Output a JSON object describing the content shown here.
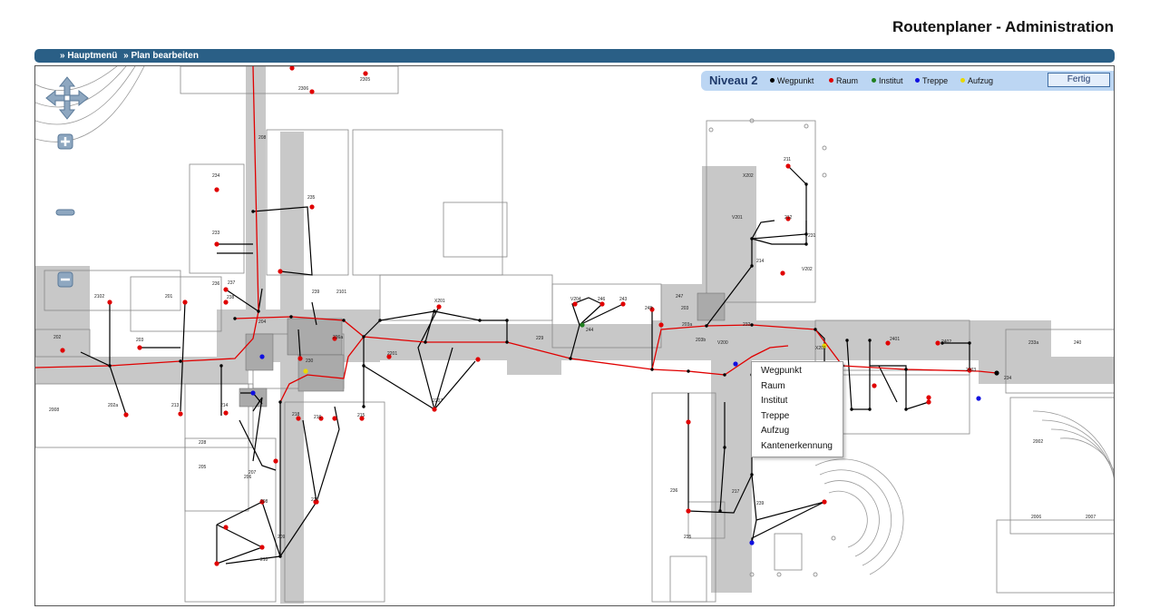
{
  "header": {
    "title": "Routenplaner - Administration"
  },
  "breadcrumb": {
    "items": [
      "» Hauptmenü",
      "» Plan bearbeiten"
    ]
  },
  "legend": {
    "level": "Niveau 2",
    "items": [
      {
        "label": "Wegpunkt",
        "color": "#000000"
      },
      {
        "label": "Raum",
        "color": "#e00000"
      },
      {
        "label": "Institut",
        "color": "#208020"
      },
      {
        "label": "Treppe",
        "color": "#1010e0"
      },
      {
        "label": "Aufzug",
        "color": "#e8d800"
      }
    ],
    "done_button": "Fertig"
  },
  "context_menu": {
    "items": [
      "Wegpunkt",
      "Raum",
      "Institut",
      "Treppe",
      "Aufzug",
      "Kantenerkennung"
    ]
  },
  "map": {
    "room_labels": [
      "2306",
      "2305",
      "208",
      "234",
      "235",
      "233",
      "236",
      "237",
      "238",
      "239",
      "2101",
      "2102",
      "201",
      "202",
      "203",
      "204",
      "230",
      "236a",
      "X201",
      "2201",
      "229",
      "2207",
      "V204",
      "246",
      "243",
      "244",
      "245",
      "247",
      "203",
      "203a",
      "203b",
      "V200",
      "X201",
      "232",
      "V202",
      "211",
      "X202",
      "V201",
      "212",
      "214",
      "231",
      "2401",
      "2402",
      "2403",
      "234",
      "233a",
      "240",
      "2001",
      "2002",
      "2006",
      "2007",
      "2008",
      "202a",
      "213",
      "214",
      "218",
      "216",
      "215",
      "228",
      "205",
      "206",
      "207",
      "208",
      "217",
      "209",
      "210",
      "217",
      "236",
      "235",
      "239"
    ],
    "colors": {
      "corridor": "#c8c8c8",
      "route_red": "#e00000",
      "edge_black": "#000000",
      "bar": "#2a5f86",
      "legend_bg": "#bcd6f3"
    }
  }
}
